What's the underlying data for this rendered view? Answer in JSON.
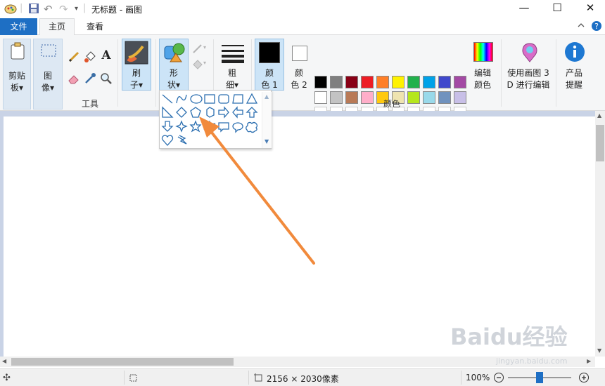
{
  "titlebar": {
    "title": "无标题 - 画图",
    "minimize": "—",
    "maximize": "☐",
    "close": "✕"
  },
  "tabs": {
    "file": "文件",
    "home": "主页",
    "view": "查看",
    "collapse_icon": "chevron-up-icon"
  },
  "ribbon": {
    "clipboard": {
      "label1": "剪贴",
      "label2": "板▾"
    },
    "image": {
      "label1": "图",
      "label2": "像▾"
    },
    "tools_label": "工具",
    "brush": {
      "label1": "刷",
      "label2": "子▾"
    },
    "shapes": {
      "label1": "形",
      "label2": "状▾"
    },
    "size": {
      "label1": "粗",
      "label2": "细▾"
    },
    "color1": {
      "label1": "颜",
      "label2": "色 1"
    },
    "color2": {
      "label1": "颜",
      "label2": "色 2"
    },
    "colors_label": "颜色",
    "edit_colors": {
      "label1": "编辑",
      "label2": "颜色"
    },
    "paint3d": {
      "label1": "使用画图 3",
      "label2": "D 进行编辑"
    },
    "product_alert": {
      "label1": "产品",
      "label2": "提醒"
    }
  },
  "palette": {
    "row1": [
      "#000000",
      "#7f7f7f",
      "#880015",
      "#ed1c24",
      "#ff7f27",
      "#fff200",
      "#22b14c",
      "#00a2e8",
      "#3f48cc",
      "#a349a4"
    ],
    "row2": [
      "#ffffff",
      "#c3c3c3",
      "#b97a57",
      "#ffaec9",
      "#ffc90e",
      "#efe4b0",
      "#b5e61d",
      "#99d9ea",
      "#7092be",
      "#c8bfe7"
    ],
    "color1": "#000000",
    "color2": "#ffffff"
  },
  "status": {
    "dimensions": "2156 × 2030像素",
    "zoom": "100%",
    "zoom_level_fraction": 0.5
  },
  "watermark": {
    "text": "Baidu经验",
    "url": "jingyan.baidu.com"
  }
}
